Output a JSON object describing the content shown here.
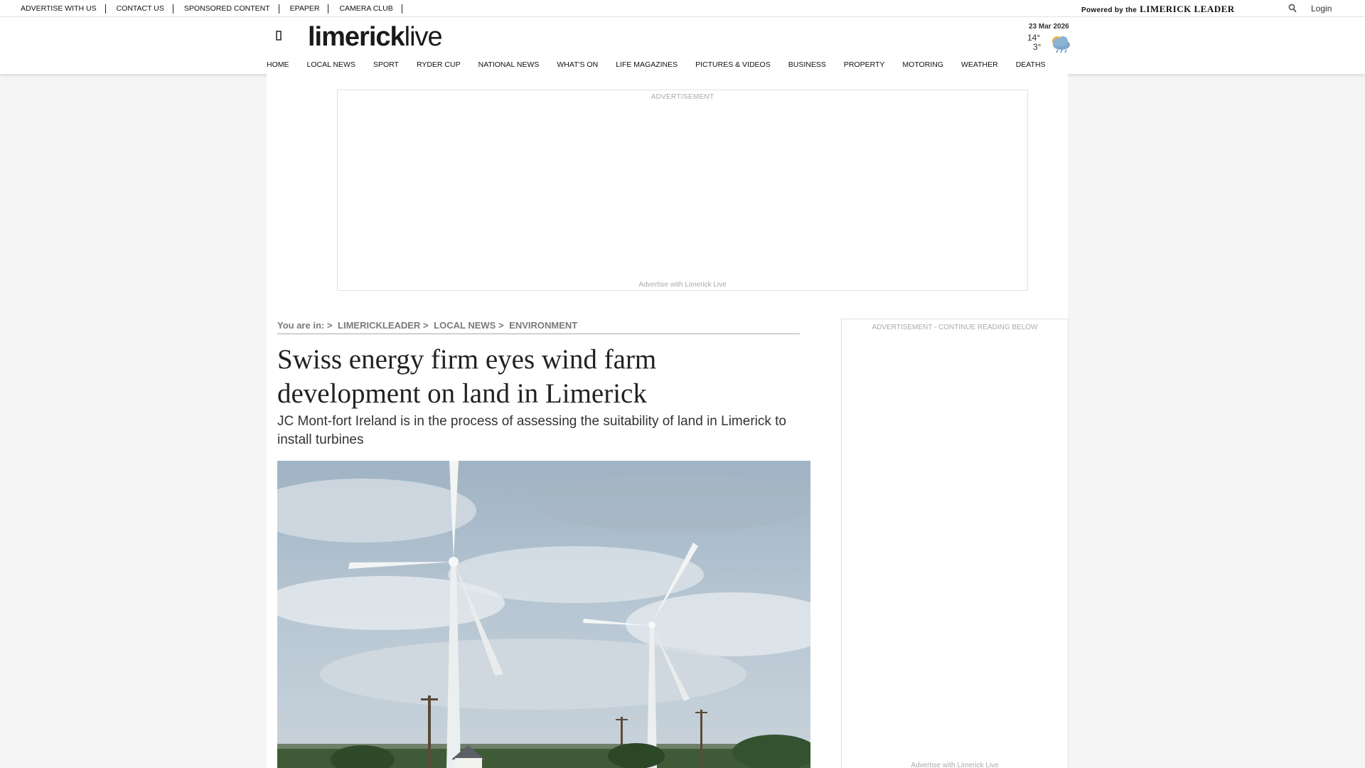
{
  "topbar": {
    "links": [
      "ADVERTISE WITH US",
      "CONTACT US",
      "SPONSORED CONTENT",
      "EPAPER",
      "CAMERA CLUB"
    ],
    "powered_prefix": "Powered by the",
    "powered_brand": "LIMERICK LEADER",
    "login_label": "Login",
    "search_icon": "search-icon"
  },
  "header": {
    "logo_bold": "limerick",
    "logo_light": "live",
    "menu_icon": "hamburger-icon",
    "weather": {
      "date": "23 Mar 2026",
      "high": "14°",
      "low": "3°",
      "icon": "cloud-rain-icon"
    },
    "nav": [
      "HOME",
      "LOCAL NEWS",
      "SPORT",
      "RYDER CUP",
      "NATIONAL NEWS",
      "WHAT'S ON",
      "LIFE MAGAZINES",
      "PICTURES & VIDEOS",
      "BUSINESS",
      "PROPERTY",
      "MOTORING",
      "WEATHER",
      "DEATHS"
    ]
  },
  "ads": {
    "top_label": "ADVERTISEMENT",
    "top_footer": "Advertise with Limerick Live",
    "side_label": "ADVERTISEMENT - CONTINUE READING BELOW",
    "side_footer": "Advertise with Limerick Live"
  },
  "breadcrumb": {
    "prefix": "You are in: >",
    "items": [
      "LIMERICKLEADER",
      "LOCAL NEWS",
      "ENVIRONMENT"
    ]
  },
  "article": {
    "headline": "Swiss energy firm eyes wind farm development on land in Limerick",
    "standfirst": "JC Mont-fort Ireland is in the process of assessing the suitability of land in Limerick to install turbines"
  },
  "colors": {
    "background": "#f5f5f5",
    "text": "#222222",
    "breadcrumb": "#7a7a7a",
    "ad_text": "#aaaaaa"
  }
}
